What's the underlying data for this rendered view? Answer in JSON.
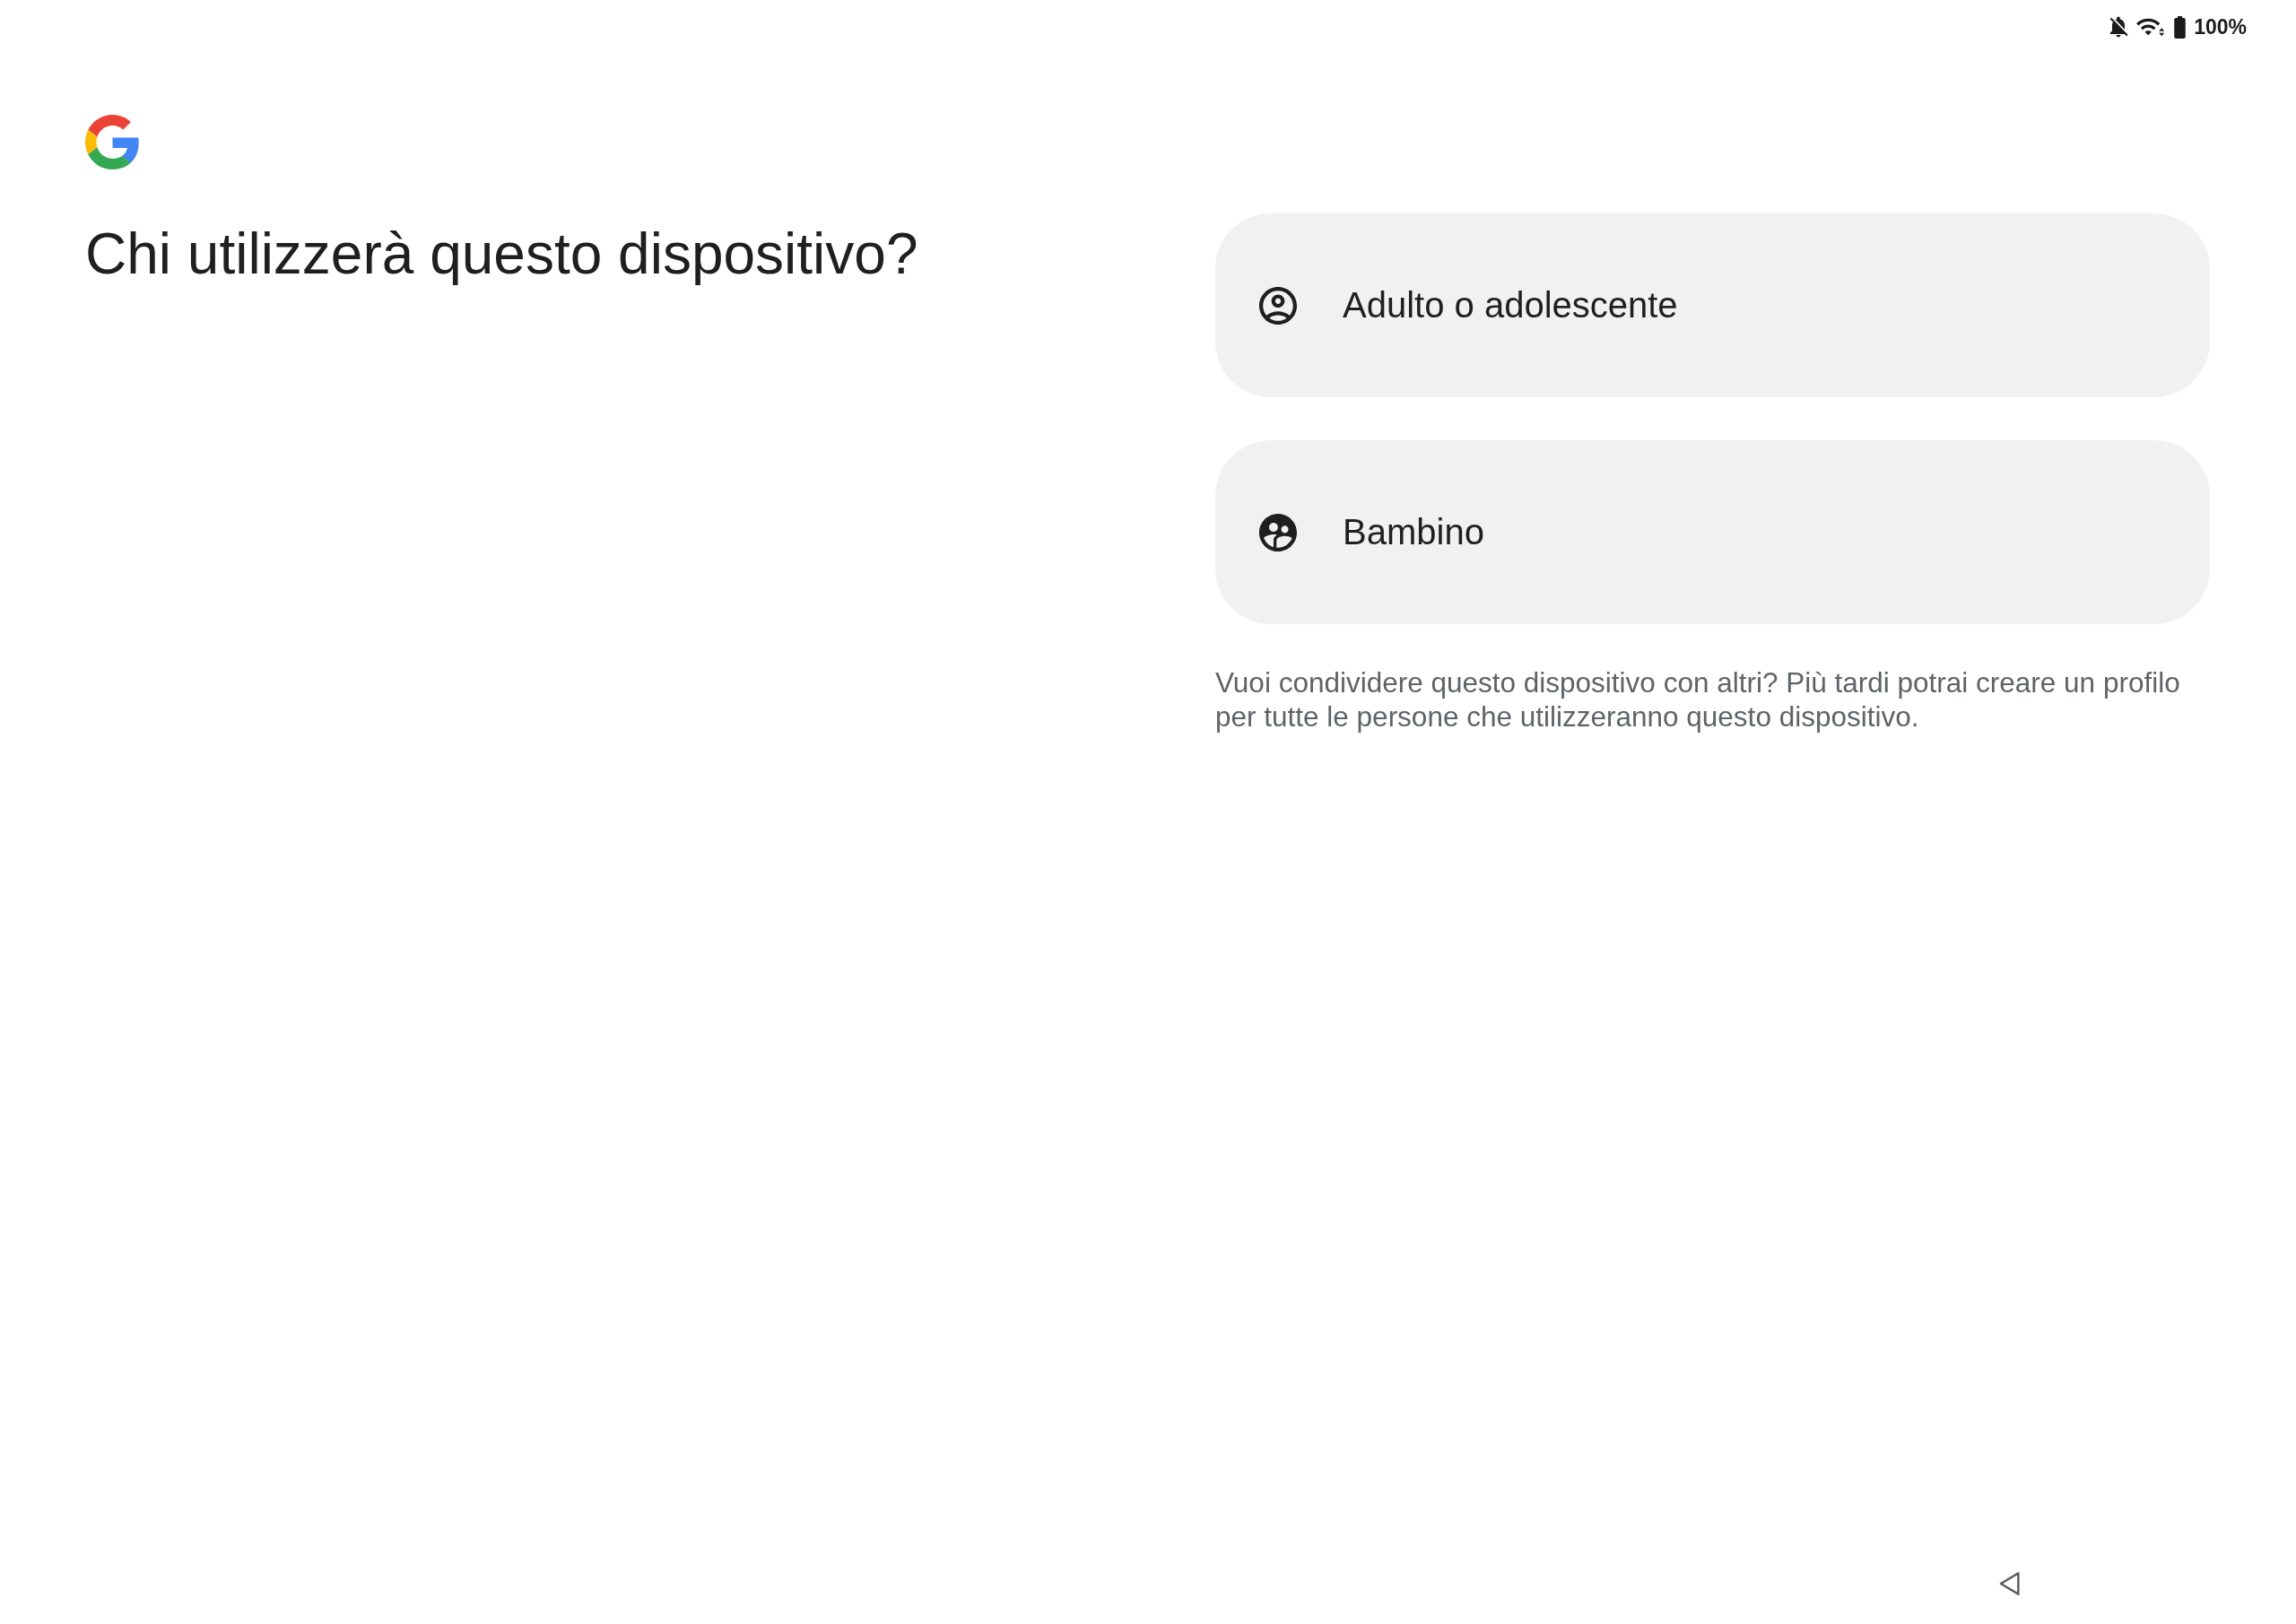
{
  "status_bar": {
    "battery": "100%"
  },
  "title": "Chi utilizzerà questo dispositivo?",
  "options": [
    {
      "kind": "adult",
      "label": "Adulto o adolescente"
    },
    {
      "kind": "child",
      "label": "Bambino"
    }
  ],
  "note": "Vuoi condividere questo dispositivo con altri? Più tardi potrai creare un profilo per tutte le persone che utilizzeranno questo dispositivo."
}
